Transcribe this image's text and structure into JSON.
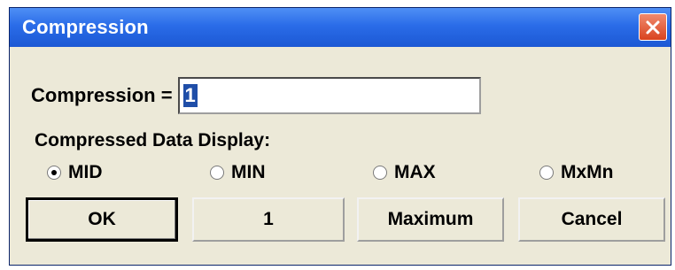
{
  "window": {
    "title": "Compression"
  },
  "compression": {
    "label": "Compression =",
    "value": "1"
  },
  "display": {
    "label": "Compressed Data Display:",
    "options": [
      {
        "label": "MID",
        "checked": true
      },
      {
        "label": "MIN",
        "checked": false
      },
      {
        "label": "MAX",
        "checked": false
      },
      {
        "label": "MxMn",
        "checked": false
      }
    ]
  },
  "buttons": {
    "ok": "OK",
    "one": "1",
    "maximum": "Maximum",
    "cancel": "Cancel"
  },
  "colors": {
    "titlebar": "#2a6ce8",
    "dialog_bg": "#ece9d8",
    "close": "#d9431f",
    "selection": "#1f4ea8"
  }
}
